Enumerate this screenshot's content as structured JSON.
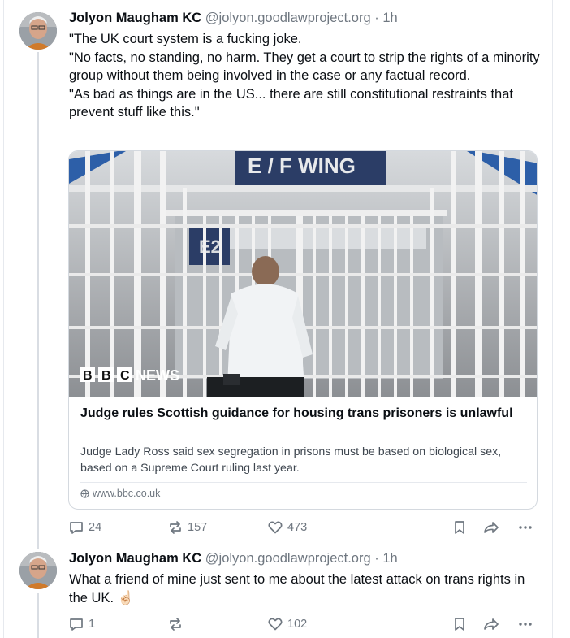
{
  "posts": [
    {
      "author": "Jolyon Maugham KC",
      "handle": "@jolyon.goodlawproject.org",
      "separator": "·",
      "time": "1h",
      "paragraphs": [
        "\"The UK court system is a fucking joke.",
        "\"No facts, no standing, no harm. They get a court to strip the rights of a minority group without them being involved in the case or any factual record.",
        "\"As bad as things are in the US... there are still constitutional restraints that prevent stuff like this.\""
      ],
      "card": {
        "image_sign": "E / F  WING",
        "image_door_sign": "E2",
        "image_brand": "NEWS",
        "image_brand_letters": [
          "B",
          "B",
          "C"
        ],
        "title": "Judge rules Scottish guidance for housing trans prisoners is unlawful",
        "description": "Judge Lady Ross said sex segregation in prisons must be based on biological sex, based on a Supreme Court ruling last year.",
        "domain": "www.bbc.co.uk"
      },
      "replies": "24",
      "reposts": "157",
      "likes": "473"
    },
    {
      "author": "Jolyon Maugham KC",
      "handle": "@jolyon.goodlawproject.org",
      "separator": "·",
      "time": "1h",
      "text": "What a friend of mine just sent to me about the latest attack on trans rights in the UK.",
      "emoji": "☝🏻",
      "replies": "1",
      "reposts": "",
      "likes": "102"
    }
  ],
  "colors": {
    "text": "#0b0f14",
    "muted": "#6f7780",
    "border": "#d4d9df",
    "thread_line": "#d9dde3"
  },
  "icons": [
    "reply-icon",
    "repost-icon",
    "like-icon",
    "bookmark-icon",
    "share-icon",
    "more-icon",
    "globe-icon"
  ]
}
